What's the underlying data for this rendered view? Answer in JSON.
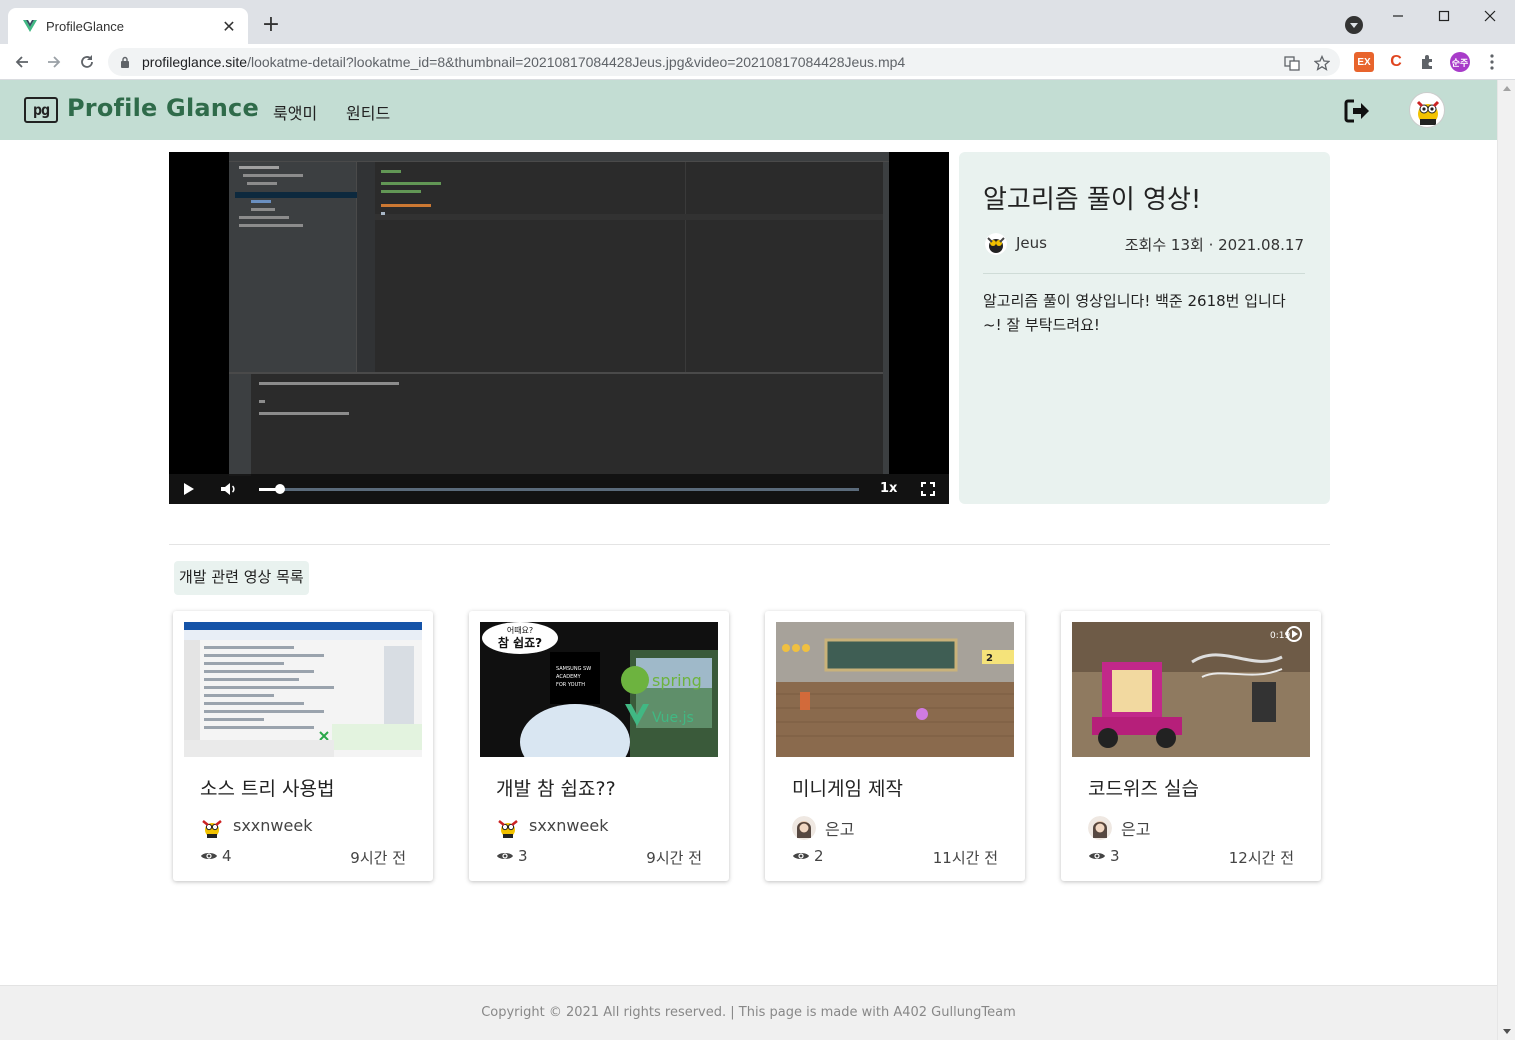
{
  "browser": {
    "tab_title": "ProfileGlance",
    "new_tab_label": "+",
    "url_host": "profileglance.site",
    "url_path": "/lookatme-detail?lookatme_id=8&thumbnail=20210817084428Jeus.jpg&video=20210817084428Jeus.mp4",
    "profile_badge": "순주"
  },
  "header": {
    "logo_mark": "pg",
    "logo_text": "Profile Glance",
    "nav": [
      "룩앳미",
      "원티드"
    ]
  },
  "video": {
    "progress": 0.035,
    "speed_label": "1x"
  },
  "detail": {
    "title": "알고리즘 풀이 영상!",
    "author": "Jeus",
    "meta": "조회수 13회 · 2021.08.17",
    "description": "알고리즘 풀이 영상입니다! 백준 2618번 입니다 ~! 잘 부탁드려요!"
  },
  "related": {
    "heading": "개발 관련 영상 목록",
    "cards": [
      {
        "title": "소스 트리 사용법",
        "author": "sxxnweek",
        "views": "4",
        "time": "9시간 전"
      },
      {
        "title": "개발 참 쉽죠??",
        "author": "sxxnweek",
        "views": "3",
        "time": "9시간 전"
      },
      {
        "title": "미니게임 제작",
        "author": "은고",
        "views": "2",
        "time": "11시간 전"
      },
      {
        "title": "코드위즈 실습",
        "author": "은고",
        "views": "3",
        "time": "12시간 전"
      }
    ],
    "thumb_texts": {
      "bob_bubble_1": "어때요?",
      "bob_bubble_2": "참 쉽죠?",
      "bob_sign": "SAMSUNG SW ACADEMY FOR YOUTH",
      "spring": "spring",
      "vue": "Vue.js",
      "game_counter": "2",
      "codewiz_time": "0:19"
    }
  },
  "footer": {
    "text": "Copyright © 2021 All rights reserved. | This page is made with A402 GullungTeam"
  },
  "colors": {
    "header_bg": "#c3ddd3",
    "logo_green": "#2f6b4a",
    "panel_bg": "#e9f2ef"
  }
}
